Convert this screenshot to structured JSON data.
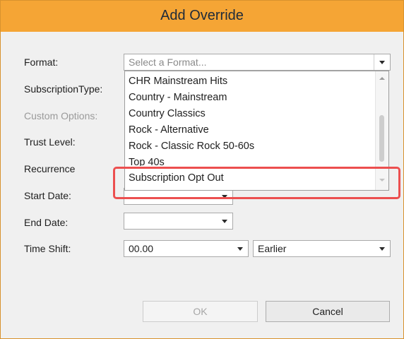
{
  "window": {
    "title": "Add Override"
  },
  "labels": {
    "format": "Format:",
    "subscription_type": "SubscriptionType:",
    "custom_options": "Custom Options:",
    "trust_level": "Trust Level:",
    "recurrence": "Recurrence",
    "start_date": "Start Date:",
    "end_date": "End Date:",
    "time_shift": "Time Shift:"
  },
  "format_combo": {
    "placeholder": "Select a Format..."
  },
  "format_options": [
    "CHR Mainstream Hits",
    "Country - Mainstream",
    "Country Classics",
    "Rock - Alternative",
    "Rock - Classic Rock 50-60s",
    "Top 40s",
    "Subscription Opt Out"
  ],
  "end_date": {
    "value": ""
  },
  "time_shift": {
    "value": "00.00",
    "direction": "Earlier"
  },
  "buttons": {
    "ok": "OK",
    "cancel": "Cancel"
  },
  "colors": {
    "titlebar": "#f5a535",
    "highlight": "#ec4f4f"
  }
}
